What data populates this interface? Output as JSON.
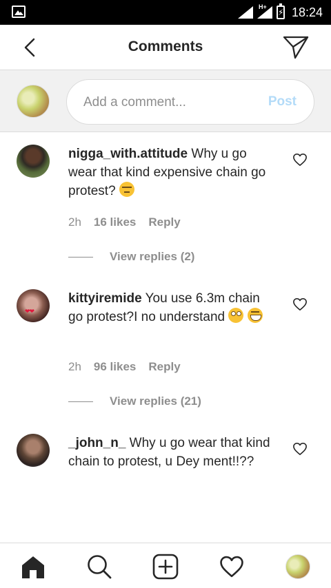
{
  "status_bar": {
    "network": "H+",
    "time": "18:24"
  },
  "header": {
    "title": "Comments"
  },
  "composer": {
    "placeholder": "Add a comment...",
    "post_label": "Post"
  },
  "comments": [
    {
      "username": "nigga_with.attitude",
      "text": " Why u go wear that kind expensive chain go protest? ",
      "emoji": [
        "angry-face-emoji"
      ],
      "time": "2h",
      "likes": "16 likes",
      "reply_label": "Reply",
      "view_replies": "View replies (2)"
    },
    {
      "username": "kittyiremide",
      "text": " You use 6.3m chain go protest?I no understand ",
      "emoji": [
        "eye-roll-emoji",
        "grinning-emoji"
      ],
      "time": "2h",
      "likes": "96 likes",
      "reply_label": "Reply",
      "view_replies": "View replies (21)"
    },
    {
      "username": "_john_n_",
      "text": " Why u go wear that kind chain to protest, u Dey ment!!??"
    }
  ],
  "colors": {
    "post_disabled": "#b3dbf8",
    "secondary_text": "#8e8e8e",
    "divider": "#dbdbdb"
  }
}
